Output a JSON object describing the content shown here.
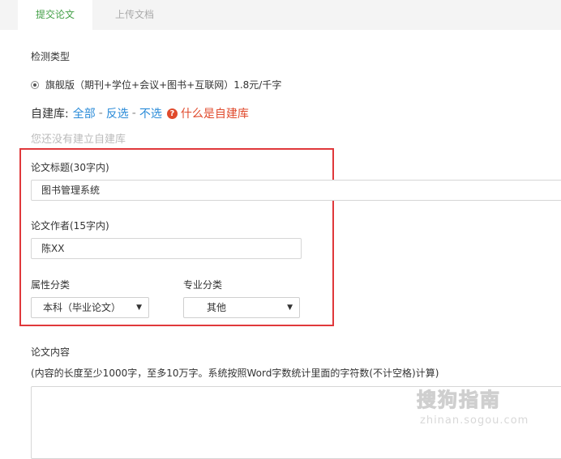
{
  "tabs": [
    {
      "label": "提交论文",
      "active": true
    },
    {
      "label": "上传文档",
      "active": false
    }
  ],
  "detect_type": {
    "label": "检测类型",
    "option": "旗舰版（期刊+学位+会议+图书+互联网）1.8元/千字",
    "selected": true
  },
  "self_library": {
    "prefix": "自建库:",
    "all": "全部",
    "invert": "反选",
    "none": "不选",
    "separator": "-",
    "help_icon": "question-circle-icon",
    "help_text": "什么是自建库",
    "empty_note": "您还没有建立自建库"
  },
  "form": {
    "title_label": "论文标题(30字内)",
    "title_value": "图书管理系统",
    "author_label": "论文作者(15字内)",
    "author_value": "陈XX",
    "attr_label": "属性分类",
    "attr_value": "本科（毕业论文）",
    "major_label": "专业分类",
    "major_value": "其他",
    "content_label": "论文内容",
    "content_hint": "(内容的长度至少1000字，至多10万字。系统按照Word字数统计里面的字符数(不计空格)计算)"
  },
  "watermark": {
    "main": "搜狗指南",
    "sub": "zhinan.sogou.com"
  },
  "colors": {
    "accent": "#43a047",
    "link": "#2a8bd8",
    "help": "#e04a2c",
    "highlight_box": "#e0383b"
  }
}
